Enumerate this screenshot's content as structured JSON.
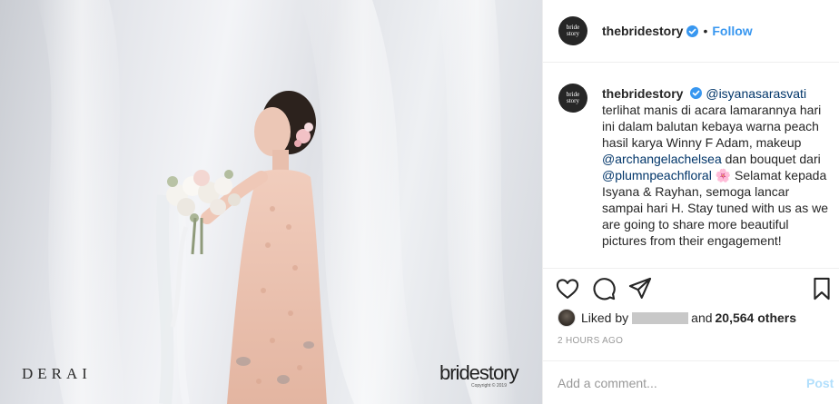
{
  "photo": {
    "watermark_left": "DERAI",
    "watermark_right": "bridestory",
    "watermark_copyright": "Copyright © 2019"
  },
  "header": {
    "avatar_text_top": "bride",
    "avatar_text_bottom": "story",
    "username": "thebridestory",
    "separator": "•",
    "follow_label": "Follow"
  },
  "caption": {
    "username": "thebridestory",
    "mention_1": "@isyanasarasvati",
    "text_1": " terlihat manis di acara lamarannya hari ini dalam balutan kebaya warna peach hasil karya Winny F Adam, makeup ",
    "mention_2": "@archangelachelsea",
    "text_2": " dan bouquet dari ",
    "mention_3": "@plumnpeachfloral",
    "text_3": " 🌸 Selamat kepada Isyana & Rayhan, semoga lancar sampai hari H. Stay tuned with us as we are going to share more beautiful pictures from their engagement!"
  },
  "actions": {
    "like_icon": "heart-icon",
    "comment_icon": "comment-icon",
    "share_icon": "paper-plane-icon",
    "save_icon": "bookmark-icon"
  },
  "likes": {
    "prefix": "Liked by",
    "suffix": "and",
    "count": "20,564 others"
  },
  "timestamp": "2 HOURS AGO",
  "comment": {
    "placeholder": "Add a comment...",
    "post_label": "Post"
  },
  "colors": {
    "link": "#3897f0",
    "mention": "#003569",
    "post_disabled": "#b2dffc",
    "muted": "#999999"
  }
}
